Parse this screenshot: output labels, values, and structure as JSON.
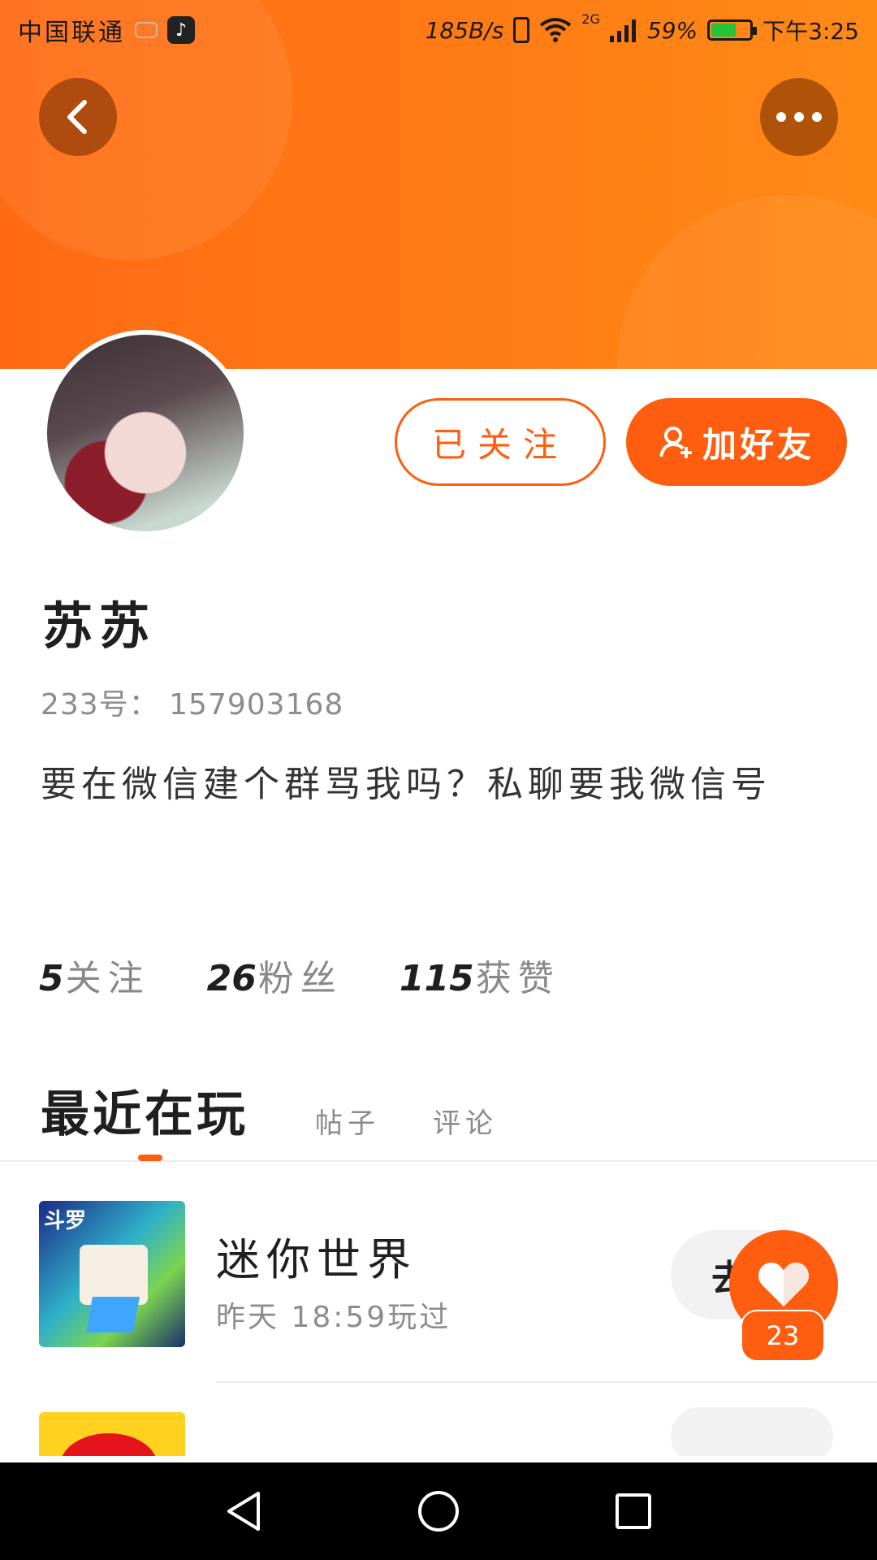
{
  "status_bar": {
    "carrier": "中国联通",
    "net_speed": "185B/s",
    "network_type": "2G",
    "battery_percent": "59%",
    "battery_level": 0.59,
    "time": "下午3:25"
  },
  "profile": {
    "name": "苏苏",
    "account_id": "233号： 157903168",
    "bio": "要在微信建个群骂我吗？私聊要我微信号",
    "followed_label": "已关注",
    "add_friend_label": "加好友"
  },
  "stats": {
    "following_count": "5",
    "following_label": "关注",
    "fans_count": "26",
    "fans_label": "粉丝",
    "likes_count": "115",
    "likes_label": "获赞"
  },
  "tabs": [
    {
      "label": "最近在玩"
    },
    {
      "label": "帖子"
    },
    {
      "label": "评论"
    }
  ],
  "games": [
    {
      "name": "迷你世界",
      "played": "昨天 18:59玩过",
      "thumb_tag": "斗罗",
      "button": "去"
    }
  ],
  "like_badge": "23",
  "colors": {
    "accent": "#ff5e10",
    "header_start": "#ff6a13",
    "header_end": "#ff8a16"
  }
}
